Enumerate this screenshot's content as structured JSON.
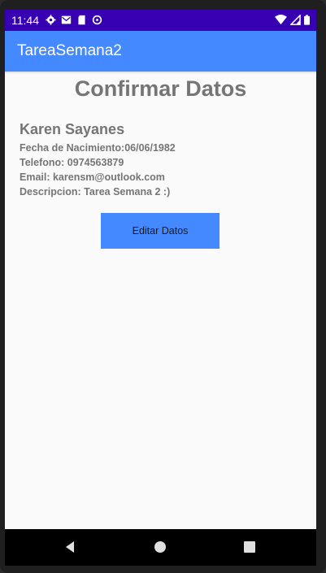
{
  "status_bar": {
    "time": "11:44",
    "background": "#3700b3",
    "left_icons": [
      "gear-icon",
      "mail-icon",
      "sd-card-icon",
      "data-saver-icon"
    ],
    "right_icons": [
      "wifi-icon",
      "signal-icon",
      "battery-icon"
    ]
  },
  "app_bar": {
    "title": "TareaSemana2",
    "color": "#4489ff"
  },
  "content": {
    "heading": "Confirmar Datos",
    "name": "Karen Sayanes",
    "birth_date": "Fecha de Nacimiento:06/06/1982",
    "phone": "Telefono: 0974563879",
    "email": "Email: karensm@outlook.com",
    "description": "Descripcion: Tarea Semana 2 :)"
  },
  "actions": {
    "edit_label": "Editar Datos",
    "button_color": "#4489ff"
  },
  "nav_bar": {
    "buttons": [
      "back-icon",
      "home-icon",
      "recents-icon"
    ]
  }
}
